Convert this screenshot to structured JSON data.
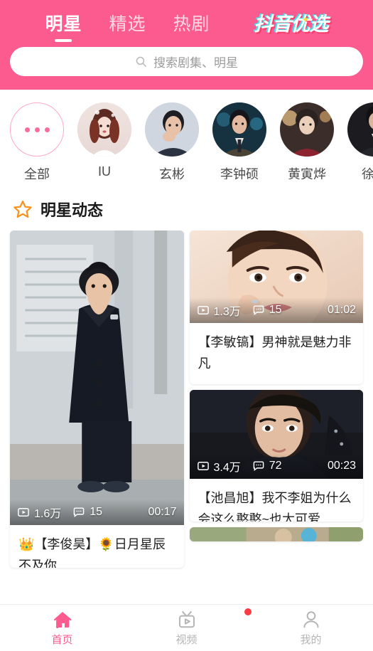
{
  "theme": {
    "brand_pink": "#FB5B8E",
    "accent_orange": "#F7931E",
    "badge_red": "#FB3B44"
  },
  "header": {
    "tabs": [
      {
        "label": "明星",
        "active": true
      },
      {
        "label": "精选",
        "active": false
      },
      {
        "label": "热剧",
        "active": false
      }
    ],
    "logo": "抖音优选",
    "search": {
      "placeholder": "搜索剧集、明星",
      "value": "",
      "icon": "search-icon"
    }
  },
  "stars": {
    "items": [
      {
        "name": "全部",
        "type": "all",
        "icon": "ellipsis-icon"
      },
      {
        "name": "IU",
        "type": "avatar"
      },
      {
        "name": "玄彬",
        "type": "avatar"
      },
      {
        "name": "李钟硕",
        "type": "avatar"
      },
      {
        "name": "黄寅烨",
        "type": "avatar"
      },
      {
        "name": "徐仁",
        "type": "avatar"
      }
    ]
  },
  "section": {
    "title": "明星动态",
    "icon": "star-outline-icon"
  },
  "feed": {
    "left_column": [
      {
        "views": "1.6万",
        "comments": "15",
        "duration": "00:17",
        "title": "👑【李俊昊】🌻日月星辰 不及你"
      }
    ],
    "right_column": [
      {
        "views": "1.3万",
        "comments": "15",
        "duration": "01:02",
        "title": "【李敏镐】男神就是魅力非凡"
      },
      {
        "views": "3.4万",
        "comments": "72",
        "duration": "00:23",
        "title": "【池昌旭】我不李姐为什么会这么憨憨~也太可爱…"
      }
    ]
  },
  "bottom_nav": {
    "items": [
      {
        "label": "首页",
        "icon": "home-icon",
        "active": true,
        "badge": false
      },
      {
        "label": "视频",
        "icon": "tv-play-icon",
        "active": false,
        "badge": true
      },
      {
        "label": "我的",
        "icon": "person-icon",
        "active": false,
        "badge": false
      }
    ]
  }
}
